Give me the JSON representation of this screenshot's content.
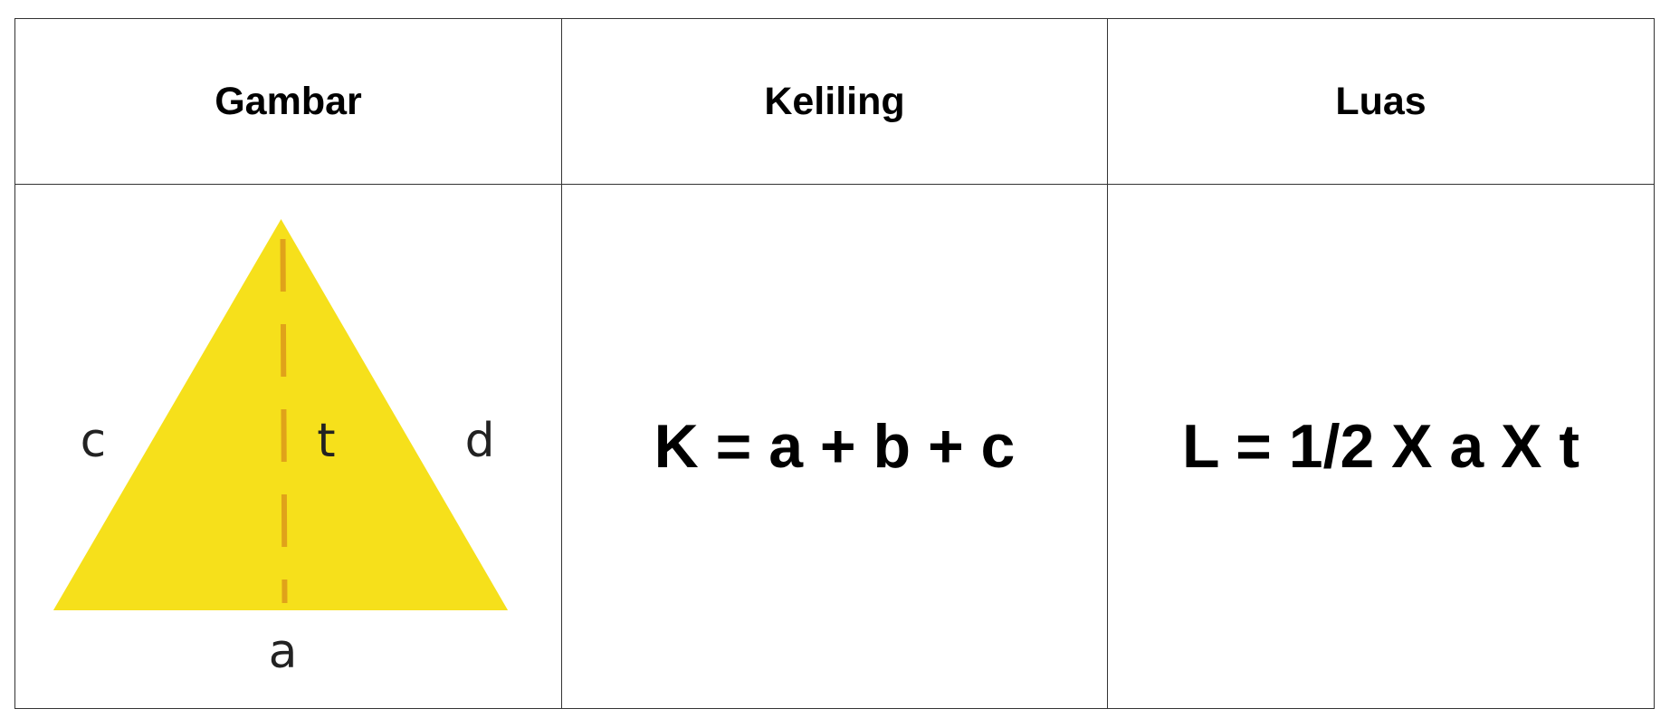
{
  "table": {
    "headers": {
      "figure": "Gambar",
      "perimeter": "Keliling",
      "area": "Luas"
    },
    "figure": {
      "shape": "triangle",
      "fill_color": "#F6E01B",
      "height_line_color": "#E0A21A",
      "labels": {
        "left_side": "c",
        "height": "t",
        "right_side": "d",
        "base": "a"
      }
    },
    "perimeter_formula": "K = a + b + c",
    "area_formula": "L = 1/2 X a X t"
  }
}
